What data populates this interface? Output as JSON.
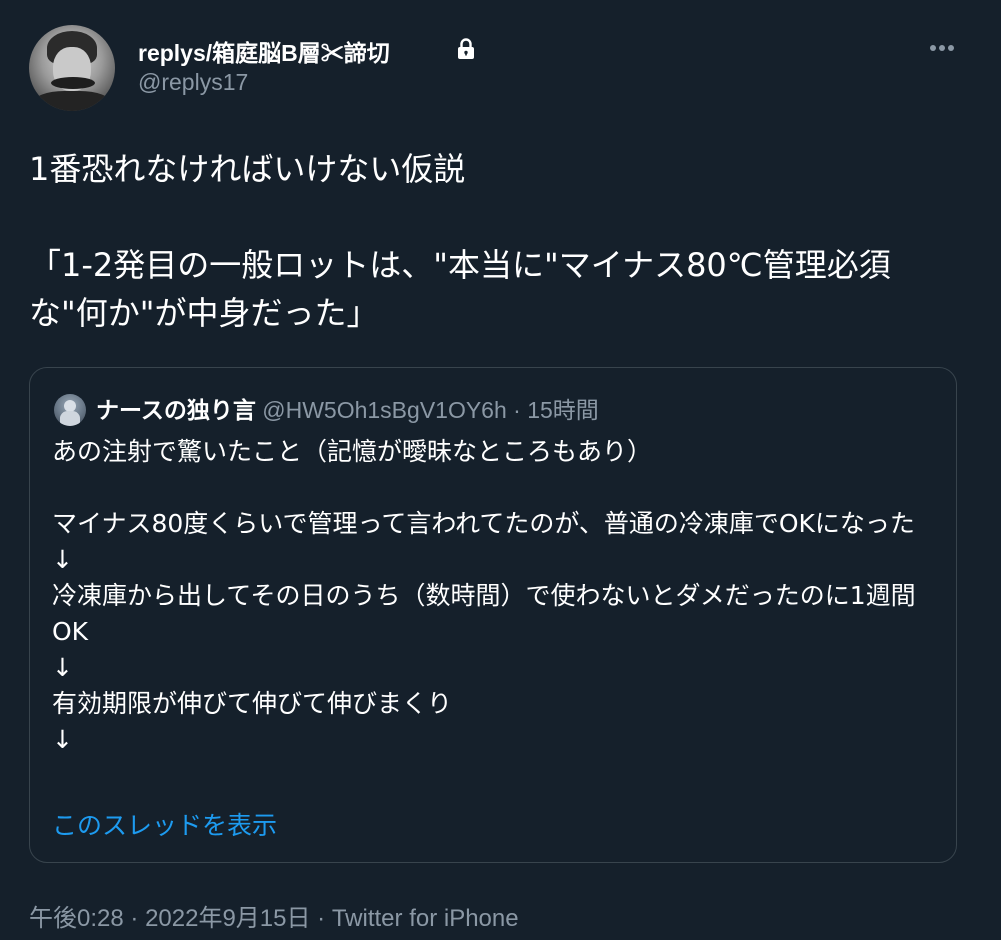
{
  "author": {
    "display_name": "replys/箱庭脳B層✂諦切",
    "handle": "@replys17",
    "avatar_icon": "portrait-avatar",
    "lock_icon": "lock-icon"
  },
  "more_icon": "more-horizontal-icon",
  "tweet": {
    "text": "1番恐れなければいけない仮説\n\n「1-2発目の一般ロットは、\"本当に\"マイナス80℃管理必須な\"何か\"が中身だった」"
  },
  "quoted_tweet": {
    "author_name": "ナースの独り言",
    "handle": "@HW5Oh1sBgV1OY6h",
    "separator": "·",
    "time_ago": "15時間",
    "text": "あの注射で驚いたこと（記憶が曖昧なところもあり）\n\nマイナス80度くらいで管理って言われてたのが、普通の冷凍庫でOKになった\n↓\n冷凍庫から出してその日のうち（数時間）で使わないとダメだったのに1週間OK\n↓\n有効期限が伸びて伸びて伸びまくり\n↓",
    "show_thread": "このスレッドを表示"
  },
  "footer": {
    "time": "午後0:28",
    "separator": "·",
    "date": "2022年9月15日",
    "source": "Twitter for iPhone"
  },
  "colors": {
    "background": "#15202b",
    "primary_text": "#ffffff",
    "secondary_text": "#8b98a5",
    "border": "#38444d",
    "link": "#1d9bf0"
  }
}
